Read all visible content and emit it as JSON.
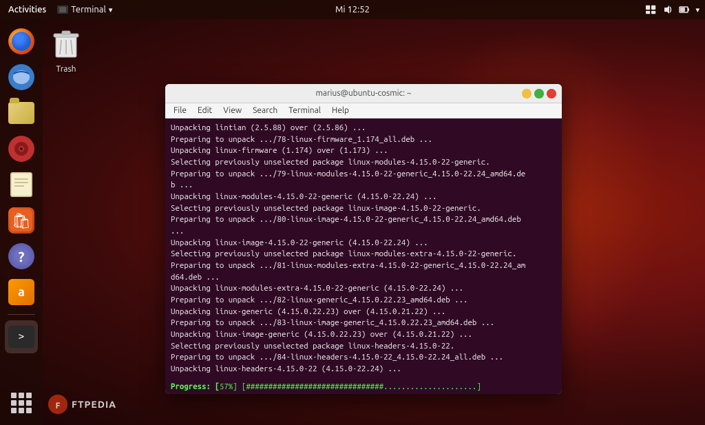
{
  "topbar": {
    "activities": "Activities",
    "terminal_label": "Terminal",
    "dropdown_arrow": "▾",
    "clock": "Mi 12:52"
  },
  "dock": {
    "items": [
      {
        "name": "firefox",
        "label": "Firefox"
      },
      {
        "name": "thunderbird",
        "label": "Thunderbird"
      },
      {
        "name": "files",
        "label": "Files"
      },
      {
        "name": "music",
        "label": "Music"
      },
      {
        "name": "notes",
        "label": "Notes"
      },
      {
        "name": "appcenter",
        "label": "App Center"
      },
      {
        "name": "help",
        "label": "Help"
      },
      {
        "name": "amazon",
        "label": "Amazon"
      },
      {
        "name": "terminal",
        "label": "Terminal"
      },
      {
        "name": "appgrid",
        "label": "Show Applications"
      }
    ]
  },
  "desktop": {
    "trash_label": "Trash"
  },
  "footer": {
    "ftpedia": "FTPEDIA"
  },
  "terminal": {
    "title": "marius@ubuntu-cosmic: ~",
    "menu": [
      "File",
      "Edit",
      "View",
      "Search",
      "Terminal",
      "Help"
    ],
    "lines": [
      "Unpacking lintian (2.5.88) over (2.5.86) ...",
      "Preparing to unpack .../78-linux-firmware_1.174_all.deb ...",
      "Unpacking linux-firmware (1.174) over (1.173) ...",
      "Selecting previously unselected package linux-modules-4.15.0-22-generic.",
      "Preparing to unpack .../79-linux-modules-4.15.0-22-generic_4.15.0-22.24_amd64.de",
      "b ...",
      "Unpacking linux-modules-4.15.0-22-generic (4.15.0-22.24) ...",
      "Selecting previously unselected package linux-image-4.15.0-22-generic.",
      "Preparing to unpack .../80-linux-image-4.15.0-22-generic_4.15.0-22.24_amd64.deb",
      "...",
      "Unpacking linux-image-4.15.0-22-generic (4.15.0-22.24) ...",
      "Selecting previously unselected package linux-modules-extra-4.15.0-22-generic.",
      "Preparing to unpack .../81-linux-modules-extra-4.15.0-22-generic_4.15.0-22.24_am",
      "d64.deb ...",
      "Unpacking linux-modules-extra-4.15.0-22-generic (4.15.0-22.24) ...",
      "Preparing to unpack .../82-linux-generic_4.15.0.22.23_amd64.deb ...",
      "Unpacking linux-generic (4.15.0.22.23) over (4.15.0.21.22) ...",
      "Preparing to unpack .../83-linux-image-generic_4.15.0.22.23_amd64.deb ...",
      "Unpacking linux-image-generic (4.15.0.22.23) over (4.15.0.21.22) ...",
      "Selecting previously unselected package linux-headers-4.15.0-22.",
      "Preparing to unpack .../84-linux-headers-4.15.0-22_4.15.0-22.24_all.deb ...",
      "Unpacking linux-headers-4.15.0-22 (4.15.0-22.24) ..."
    ],
    "progress_label": "Progress: [",
    "progress_percent": " 57%",
    "progress_bar": "] [###############################.....................]",
    "window_controls": {
      "minimize": "minimize",
      "maximize": "maximize",
      "close": "close"
    }
  }
}
